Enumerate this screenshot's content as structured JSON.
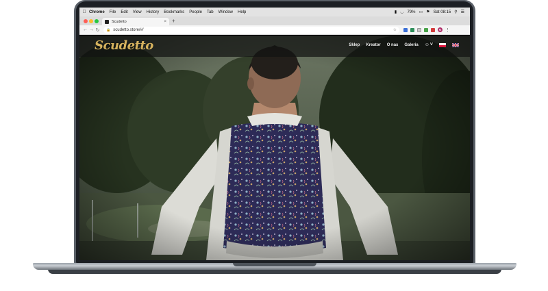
{
  "menubar": {
    "app": "Chrome",
    "items": [
      "File",
      "Edit",
      "View",
      "History",
      "Bookmarks",
      "People",
      "Tab",
      "Window",
      "Help"
    ],
    "battery": "79%",
    "clock": "Sat 08:15"
  },
  "browser": {
    "tab_title": "Scudetto",
    "url": "scudetto.store/#/",
    "profile_initial": "M"
  },
  "site": {
    "logo": "Scudetto",
    "nav": [
      "Sklep",
      "Kreator",
      "O nas",
      "Galeria"
    ]
  },
  "colors": {
    "logo_gold": "#d6b25e",
    "nav_bar": "#121412",
    "vest_base": "#2c2a55"
  }
}
